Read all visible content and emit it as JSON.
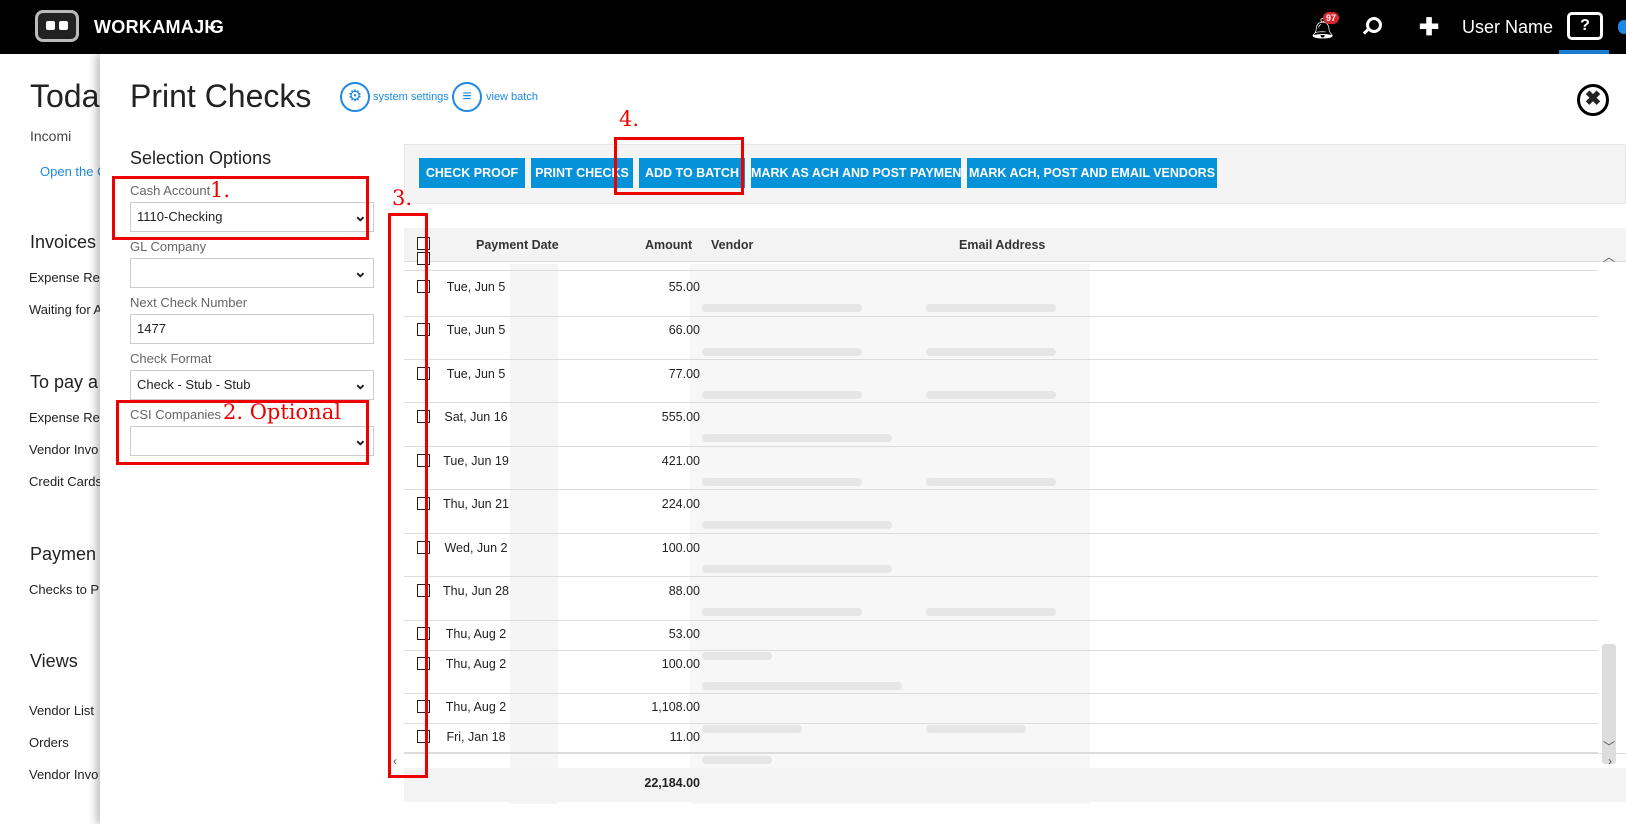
{
  "topbar": {
    "app_name": "WORKAMAJIG",
    "notification_count": "97",
    "user_name": "User Name",
    "help_label": "?"
  },
  "background_page": {
    "title": "Toda",
    "fragment": "Incomi",
    "link": "Open the C",
    "sections": [
      {
        "heading": "Invoices",
        "items": [
          "Expense Rep",
          "Waiting for A"
        ]
      },
      {
        "heading": "To pay a",
        "items": [
          "Expense Rep",
          "Vendor Invo",
          "Credit Cards"
        ]
      },
      {
        "heading": "Paymen",
        "items": [
          "Checks to Pr"
        ]
      },
      {
        "heading": "Views",
        "items": [
          "Vendor List",
          "Orders",
          "Vendor Invo"
        ]
      }
    ]
  },
  "modal": {
    "title": "Print Checks",
    "system_settings": "system settings",
    "view_batch": "view batch",
    "close": "✖"
  },
  "selection": {
    "heading": "Selection Options",
    "cash_account_label": "Cash Account",
    "cash_account_value": "1110-Checking",
    "gl_company_label": "GL Company",
    "gl_company_value": "",
    "next_check_label": "Next Check Number",
    "next_check_value": "1477",
    "check_format_label": "Check Format",
    "check_format_value": "Check - Stub - Stub",
    "csi_label": "CSI Companies",
    "csi_value": ""
  },
  "annotations": {
    "n1": "1.",
    "n2": "2. Optional",
    "n3": "3.",
    "n4": "4."
  },
  "toolbar": {
    "check_proof": "CHECK PROOF",
    "print_checks": "PRINT CHECKS",
    "add_to_batch": "ADD TO BATCH",
    "mark_ach_post": "MARK AS ACH AND POST PAYMENT",
    "mark_ach_email": "MARK ACH, POST AND EMAIL VENDORS"
  },
  "grid": {
    "columns": {
      "payment_date": "Payment Date",
      "amount": "Amount",
      "vendor": "Vendor",
      "email": "Email Address"
    },
    "rows": [
      {
        "date": "Tue, Jun 5",
        "amount": "55.00"
      },
      {
        "date": "Tue, Jun 5",
        "amount": "66.00"
      },
      {
        "date": "Tue, Jun 5",
        "amount": "77.00"
      },
      {
        "date": "Sat, Jun 16",
        "amount": "555.00"
      },
      {
        "date": "Tue, Jun 19",
        "amount": "421.00"
      },
      {
        "date": "Thu, Jun 21",
        "amount": "224.00"
      },
      {
        "date": "Wed, Jun 2",
        "amount": "100.00"
      },
      {
        "date": "Thu, Jun 28",
        "amount": "88.00"
      },
      {
        "date": "Thu, Aug 2",
        "amount": "53.00"
      },
      {
        "date": "Thu, Aug 2",
        "amount": "100.00"
      },
      {
        "date": "Thu, Aug 2",
        "amount": "1,108.00"
      },
      {
        "date": "Fri, Jan 18",
        "amount": "11.00"
      }
    ],
    "total": "22,184.00"
  },
  "colors": {
    "accent": "#0592d8",
    "annotation": "#ee0000",
    "topbar": "#000000"
  }
}
